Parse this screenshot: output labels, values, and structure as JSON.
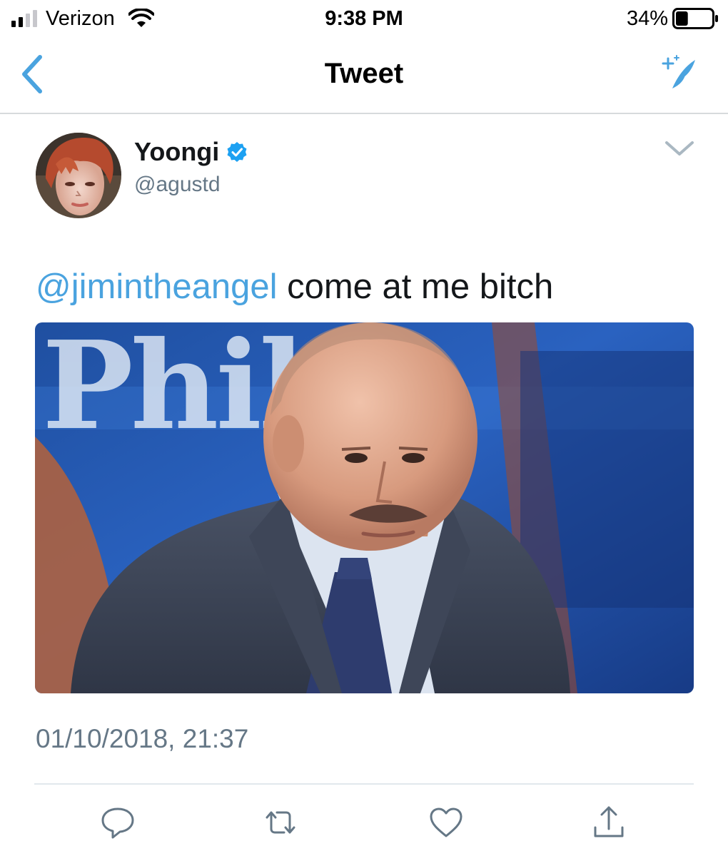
{
  "status_bar": {
    "carrier": "Verizon",
    "time": "9:38 PM",
    "battery_percent": "34%",
    "battery_level": 0.34,
    "signal_bars_filled": 2,
    "signal_bars_total": 4,
    "icons": [
      "signal-icon",
      "wifi-icon",
      "battery-icon"
    ]
  },
  "nav": {
    "title": "Tweet",
    "left_icon": "chevron-left-icon",
    "right_icon": "compose-sparkle-feather-icon",
    "accent_color": "#4aa3df"
  },
  "tweet": {
    "author": {
      "display_name": "Yoongi",
      "handle": "@agustd",
      "verified": true,
      "verified_color": "#1da1f2"
    },
    "mention": "@jimintheangel",
    "text": " come at me bitch",
    "timestamp": "01/10/2018, 21:37",
    "media": {
      "visible_text": "Phil",
      "type": "photo"
    },
    "actions": [
      {
        "name": "reply",
        "icon": "reply-icon"
      },
      {
        "name": "retweet",
        "icon": "retweet-icon"
      },
      {
        "name": "like",
        "icon": "heart-icon"
      },
      {
        "name": "share",
        "icon": "share-icon"
      }
    ]
  },
  "colors": {
    "link": "#4aa3df",
    "secondary_text": "#657786",
    "divider": "#e1e8ed",
    "icon_gray": "#657786"
  }
}
